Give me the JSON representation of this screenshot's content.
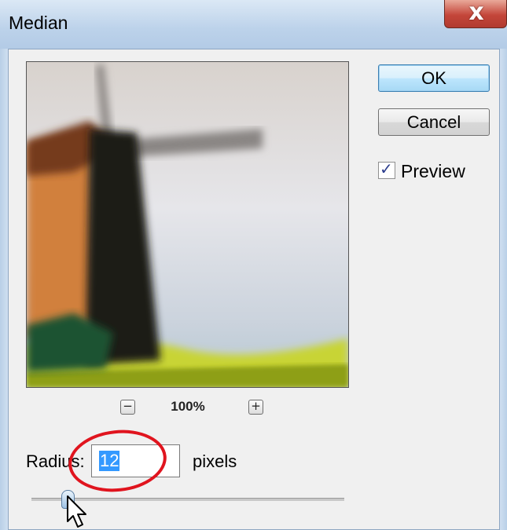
{
  "window": {
    "title": "Median",
    "close_glyph": "x"
  },
  "buttons": {
    "ok_label": "OK",
    "cancel_label": "Cancel"
  },
  "preview_option": {
    "label": "Preview",
    "checked": true,
    "check_glyph": "✓"
  },
  "zoom": {
    "out_glyph": "−",
    "in_glyph": "+",
    "level": "100%"
  },
  "radius": {
    "label": "Radius:",
    "value": "12",
    "unit": "pixels",
    "slider_fraction": 0.12
  },
  "icons": {
    "close": "close-icon",
    "check": "check-icon",
    "zoom_out": "minus-icon",
    "zoom_in": "plus-icon",
    "cursor": "mouse-cursor-icon"
  },
  "colors": {
    "annotation": "#e0141e",
    "selection": "#3399ff",
    "ok_border": "#3c7fb1"
  }
}
